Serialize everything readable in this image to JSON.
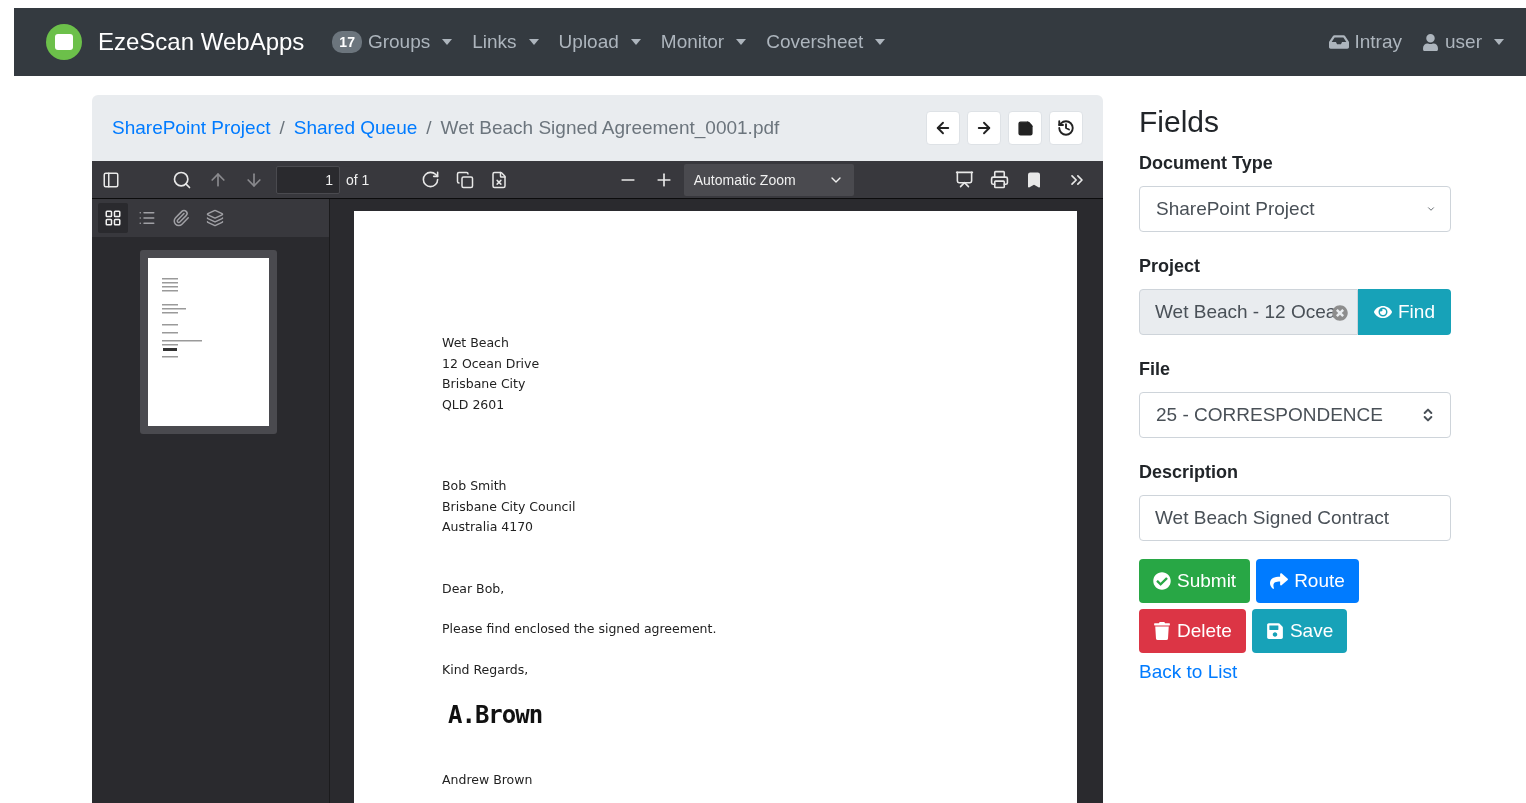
{
  "navbar": {
    "brand": "EzeScan WebApps",
    "menus": [
      {
        "label": "Groups",
        "badge": "17"
      },
      {
        "label": "Links"
      },
      {
        "label": "Upload"
      },
      {
        "label": "Monitor"
      },
      {
        "label": "Coversheet"
      }
    ],
    "right": [
      {
        "kind": "intray",
        "label": "Intray"
      },
      {
        "kind": "user",
        "label": "user"
      }
    ]
  },
  "breadcrumb": [
    {
      "label": "SharePoint Project",
      "link": true
    },
    {
      "separator": "/",
      "label": "Shared Queue",
      "link": true
    },
    {
      "separator": "/",
      "label": "Wet Beach Signed Agreement_0001.pdf",
      "link": false
    }
  ],
  "pdf_toolbar": {
    "page": "1",
    "page_count": "of 1",
    "zoom": "Automatic Zoom"
  },
  "sidebar_tabs": [
    {
      "kind": "thumbnails",
      "selected": true
    },
    {
      "kind": "outline",
      "selected": false
    },
    {
      "kind": "attachments",
      "selected": false
    },
    {
      "kind": "layers",
      "selected": false
    }
  ],
  "document": [
    {
      "kind": "address",
      "lines": [
        "Wet Beach",
        "12 Ocean Drive",
        "Brisbane City",
        "QLD 2601"
      ]
    },
    {
      "kind": "address",
      "lines": [
        "Bob Smith",
        "Brisbane City Council",
        "Australia 4170"
      ]
    },
    {
      "kind": "paragraph",
      "lines": [
        "Dear Bob,"
      ]
    },
    {
      "kind": "paragraph",
      "lines": [
        "Please find enclosed the signed agreement."
      ]
    },
    {
      "kind": "paragraph",
      "lines": [
        "Kind Regards,"
      ]
    },
    {
      "kind": "signature",
      "lines": [
        "A.Brown"
      ]
    },
    {
      "kind": "paragraph",
      "lines": [
        "Andrew Brown"
      ]
    }
  ],
  "fields": {
    "title": "Fields",
    "items": [
      {
        "kind": "dropdown",
        "label": "Document Type",
        "value": "SharePoint Project"
      },
      {
        "kind": "lookup",
        "label": "Project",
        "value": "Wet Beach - 12 Ocea",
        "button": "Find"
      },
      {
        "kind": "spinner",
        "label": "File",
        "value": "25 - CORRESPONDENCE"
      },
      {
        "kind": "text",
        "label": "Description",
        "value": "Wet Beach Signed Contract"
      }
    ],
    "buttons": [
      {
        "kind": "submit",
        "label": "Submit"
      },
      {
        "kind": "route",
        "label": "Route"
      },
      {
        "kind": "delete",
        "label": "Delete"
      },
      {
        "kind": "save",
        "label": "Save"
      }
    ],
    "back_link": "Back to List"
  }
}
